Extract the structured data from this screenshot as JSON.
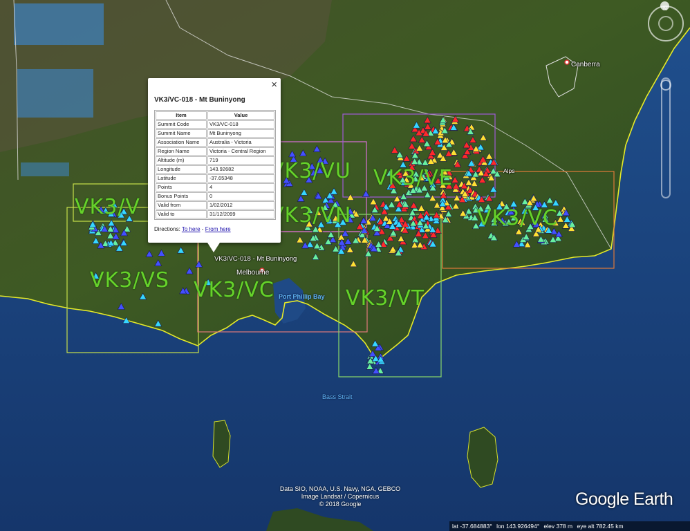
{
  "popup": {
    "title": "VK3/VC-018 - Mt Buninyong",
    "close": "×",
    "columns": [
      "Item",
      "Value"
    ],
    "rows": [
      [
        "Summit Code",
        "VK3/VC-018"
      ],
      [
        "Summit Name",
        "Mt Buninyong"
      ],
      [
        "Association Name",
        "Australia - Victoria"
      ],
      [
        "Region Name",
        "Victoria - Central Region"
      ],
      [
        "Altitude (m)",
        "719"
      ],
      [
        "Longitude",
        "143.92682"
      ],
      [
        "Latitude",
        "-37.65348"
      ],
      [
        "Points",
        "4"
      ],
      [
        "Bonus Points",
        "0"
      ],
      [
        "Valid from",
        "1/02/2012"
      ],
      [
        "Valid to",
        "31/12/2099"
      ]
    ],
    "directions_label": "Directions:",
    "to_here": "To here",
    "separator": "-",
    "from_here": "From here"
  },
  "map": {
    "region_labels": [
      "VK3/VU",
      "VK3/VN",
      "VK3/VE",
      "VK3/VC",
      "VK3/VS",
      "VK3/VC",
      "VK3/VT"
    ],
    "places": [
      "Canberra",
      "Melbourne",
      "VK3/VC-018 - Mt Buninyong",
      "Alps"
    ],
    "water_labels": [
      "Port Phillip Bay",
      "Bass Strait"
    ],
    "marker_colors": [
      "#ff2a2a",
      "#ffe033",
      "#67f0a0",
      "#36d7ff",
      "#4350ff"
    ]
  },
  "attribution": {
    "line1": "Data SIO, NOAA, U.S. Navy, NGA, GEBCO",
    "line2": "Image Landsat / Copernicus",
    "line3": "© 2018 Google"
  },
  "brand": "Google Earth",
  "nav": {
    "north": "N"
  },
  "status": {
    "lat": "lat -37.684883°",
    "lon": "lon 143.926494°",
    "elev": "elev  378 m",
    "eye_alt": "eye alt 782.45 km"
  }
}
